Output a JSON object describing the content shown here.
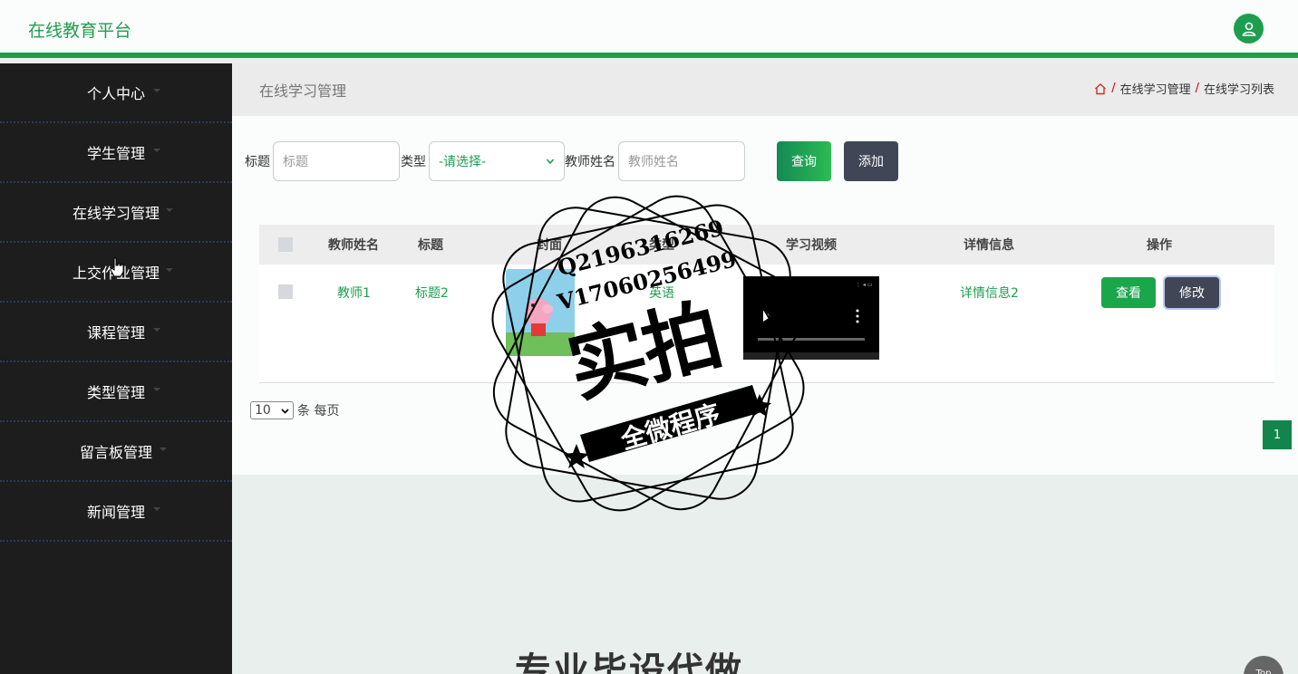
{
  "app": {
    "title": "在线教育平台"
  },
  "sidebar": {
    "items": [
      {
        "label": "个人中心"
      },
      {
        "label": "学生管理"
      },
      {
        "label": "在线学习管理"
      },
      {
        "label": "上交作业管理"
      },
      {
        "label": "课程管理"
      },
      {
        "label": "类型管理"
      },
      {
        "label": "留言板管理"
      },
      {
        "label": "新闻管理"
      }
    ]
  },
  "page": {
    "title": "在线学习管理",
    "breadcrumb": [
      "在线学习管理",
      "在线学习列表"
    ]
  },
  "search": {
    "title_label": "标题",
    "title_placeholder": "标题",
    "type_label": "类型",
    "type_selected": "-请选择-",
    "teacher_label": "教师姓名",
    "teacher_placeholder": "教师姓名",
    "query_button": "查询",
    "add_button": "添加"
  },
  "table": {
    "headers": [
      "教师姓名",
      "标题",
      "封面",
      "类型",
      "学习视频",
      "详情信息",
      "操作"
    ],
    "rows": [
      {
        "teacher": "教师1",
        "title": "标题2",
        "type": "英语",
        "details": "详情信息2",
        "view_button": "查看",
        "edit_button": "修改"
      }
    ]
  },
  "pagination": {
    "page_size": "10",
    "page_size_suffix": "条 每页",
    "current_page": "1"
  },
  "watermark": {
    "contact_q": "Q2196316269",
    "contact_v": "V17060256499",
    "big_text": "实拍",
    "ribbon_text": "全微程序"
  },
  "footer": {
    "banner_text": "专业毕设代做",
    "top_button": "Top"
  },
  "colors": {
    "primary": "#1d9e4f",
    "dark": "#1c1d1c",
    "slate": "#414656"
  }
}
